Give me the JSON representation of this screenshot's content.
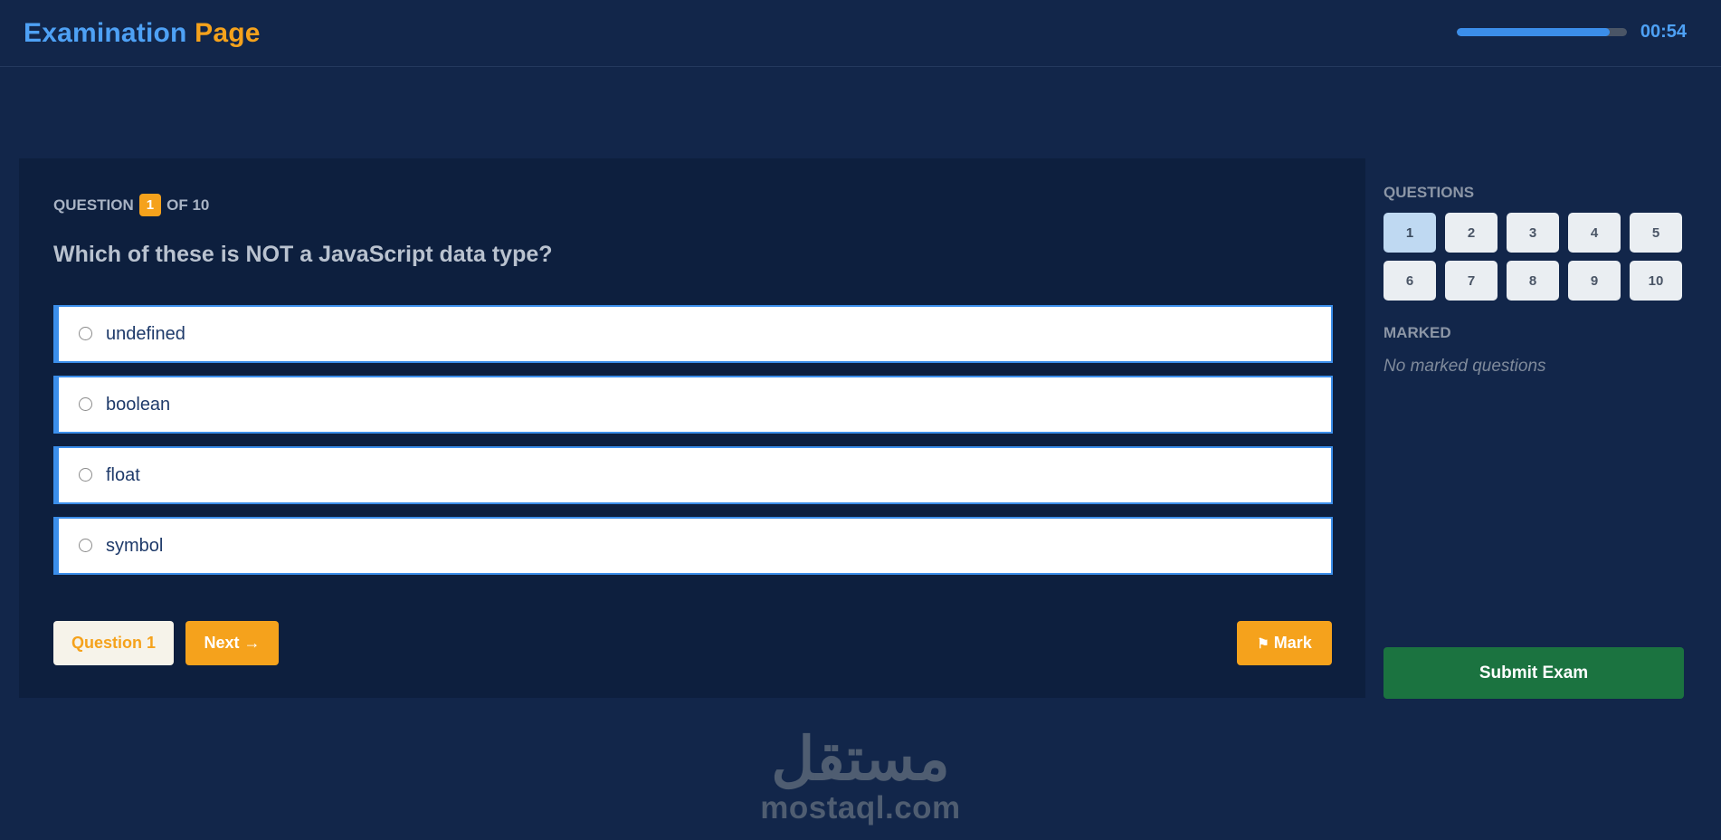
{
  "header": {
    "title_part1": "Examination",
    "title_part2": "Page",
    "timer": "00:54",
    "timer_progress": 0.9
  },
  "question": {
    "label_prefix": "QUESTION",
    "number": "1",
    "label_suffix": "OF 10",
    "text": "Which of these is NOT a JavaScript data type?",
    "options": [
      {
        "label": "undefined"
      },
      {
        "label": "boolean"
      },
      {
        "label": "float"
      },
      {
        "label": "symbol"
      }
    ]
  },
  "controls": {
    "prev_label": "Question 1",
    "next_label": "Next →",
    "mark_label": "Mark",
    "mark_icon": "flag-icon"
  },
  "sidebar": {
    "questions_heading": "QUESTIONS",
    "question_numbers": [
      "1",
      "2",
      "3",
      "4",
      "5",
      "6",
      "7",
      "8",
      "9",
      "10"
    ],
    "active_question": "1",
    "marked_heading": "MARKED",
    "no_marked_text": "No marked questions",
    "submit_label": "Submit Exam"
  },
  "watermark": {
    "logo": "مستقل",
    "text": "mostaql.com"
  },
  "colors": {
    "background": "#12264a",
    "panel": "#0d1f3e",
    "accent_blue": "#4ea1f5",
    "accent_orange": "#f5a21c",
    "submit_green": "#1b7340"
  }
}
